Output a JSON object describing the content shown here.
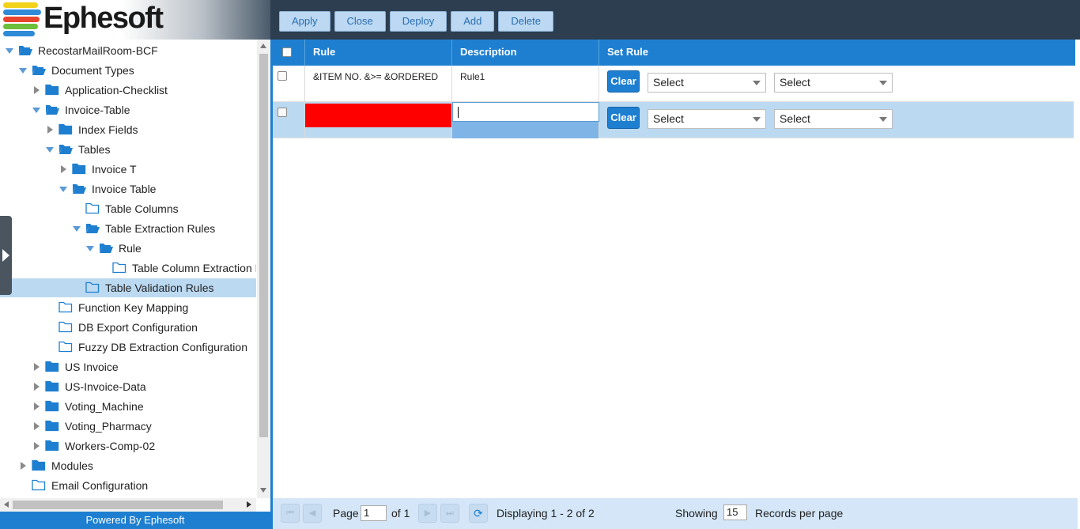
{
  "app": {
    "logo_text": "Ephesoft",
    "powered_by": "Powered By Ephesoft"
  },
  "toolbar": {
    "apply": "Apply",
    "close": "Close",
    "deploy": "Deploy",
    "add": "Add",
    "delete": "Delete"
  },
  "tree": [
    {
      "label": "RecostarMailRoom-BCF",
      "expanded": true
    },
    {
      "label": "Document Types",
      "expanded": true
    },
    {
      "label": "Application-Checklist",
      "expanded": false
    },
    {
      "label": "Invoice-Table",
      "expanded": true
    },
    {
      "label": "Index Fields",
      "expanded": false
    },
    {
      "label": "Tables",
      "expanded": true
    },
    {
      "label": "Invoice T",
      "expanded": false
    },
    {
      "label": "Invoice Table",
      "expanded": true
    },
    {
      "label": "Table Columns"
    },
    {
      "label": "Table Extraction Rules",
      "expanded": true
    },
    {
      "label": "Rule",
      "expanded": true
    },
    {
      "label": "Table Column Extraction R"
    },
    {
      "label": "Table Validation Rules",
      "selected": true
    },
    {
      "label": "Function Key Mapping"
    },
    {
      "label": "DB Export Configuration"
    },
    {
      "label": "Fuzzy DB Extraction Configuration"
    },
    {
      "label": "US Invoice",
      "expanded": false
    },
    {
      "label": "US-Invoice-Data",
      "expanded": false
    },
    {
      "label": "Voting_Machine",
      "expanded": false
    },
    {
      "label": "Voting_Pharmacy",
      "expanded": false
    },
    {
      "label": "Workers-Comp-02",
      "expanded": false
    },
    {
      "label": "Modules",
      "expanded": false
    },
    {
      "label": "Email Configuration"
    }
  ],
  "grid": {
    "headers": {
      "rule": "Rule",
      "description": "Description",
      "set_rule": "Set Rule"
    },
    "rows": [
      {
        "rule": "&ITEM NO. &>= &ORDERED",
        "description": "Rule1",
        "clear": "Clear",
        "select1": "Select",
        "select2": "Select"
      },
      {
        "rule": "",
        "description": "",
        "clear": "Clear",
        "select1": "Select",
        "select2": "Select"
      }
    ]
  },
  "pager": {
    "page_label": "Page",
    "page_value": "1",
    "of_label": "of 1",
    "displaying": "Displaying 1 - 2 of 2",
    "showing_label": "Showing",
    "per_page_value": "15",
    "records_label": "Records per page"
  },
  "colors": {
    "accent": "#1e7fd0",
    "header_bg": "#2c3e50",
    "invalid_cell": "#ff0000",
    "selected_row": "#bcd9f2"
  }
}
